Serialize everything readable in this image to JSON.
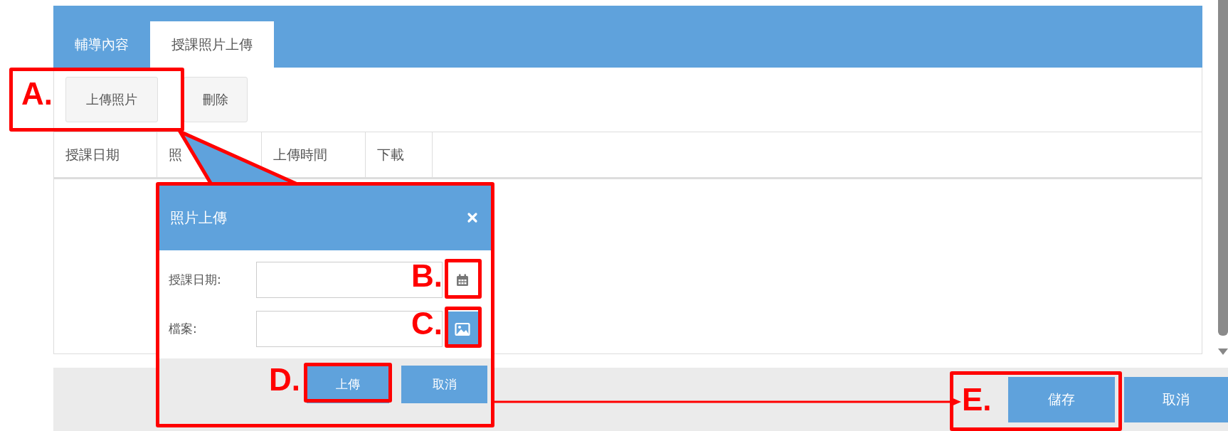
{
  "tabs": [
    {
      "label": "輔導內容",
      "selected": false
    },
    {
      "label": "授課照片上傳",
      "selected": true
    }
  ],
  "toolbar": {
    "buttons": [
      "上傳照片",
      "刪除"
    ]
  },
  "table": {
    "columns": [
      "授課日期",
      "照",
      "上傳時間",
      "下載"
    ]
  },
  "dialog": {
    "title": "照片上傳",
    "fields": [
      {
        "label": "授課日期:",
        "kind": "date"
      },
      {
        "label": "檔案:",
        "kind": "file"
      }
    ],
    "buttons": [
      "上傳",
      "取消"
    ]
  },
  "footer": {
    "buttons": [
      "儲存",
      "取消"
    ]
  },
  "annotations": [
    "A.",
    "B.",
    "C.",
    "D.",
    "E."
  ]
}
